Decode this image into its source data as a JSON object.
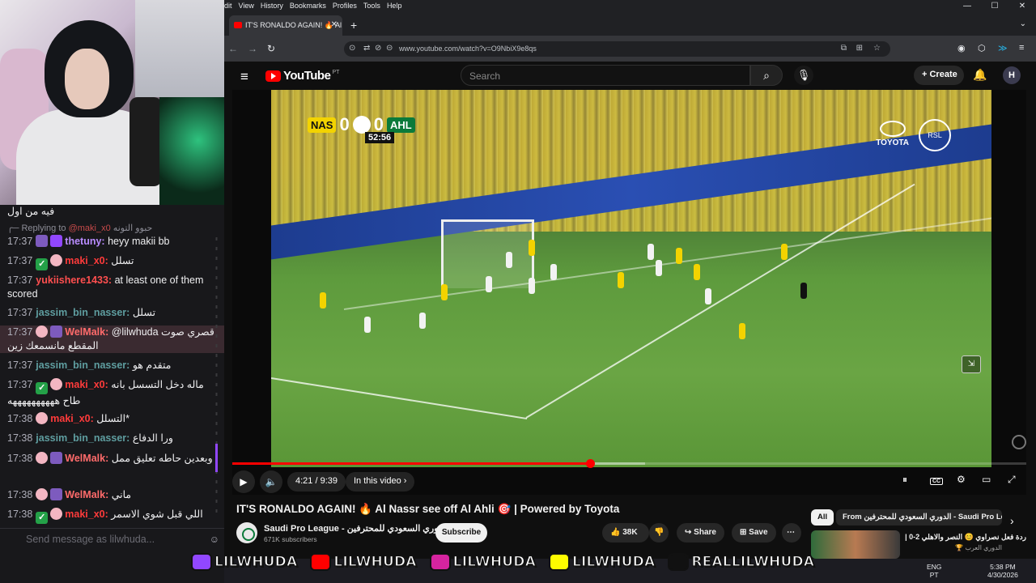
{
  "colors": {
    "accent": "#ff0000",
    "twitch_purple": "#9147ff",
    "chat_bg": "#18181b",
    "yt_bg": "#0f0f0f"
  },
  "browser": {
    "menu": [
      "dit",
      "View",
      "History",
      "Bookmarks",
      "Profiles",
      "Tools",
      "Help"
    ],
    "tab_title": "IT'S RONALDO AGAIN! 🔥 Al N",
    "url": "www.youtube.com/watch?v=O9NbiX9e8qs"
  },
  "youtube": {
    "logo_text": "YouTube",
    "region": "PT",
    "search_placeholder": "Search",
    "create_label": "Create",
    "avatar_letter": "H"
  },
  "video": {
    "scorebug": {
      "home": "NAS",
      "home_score": "0",
      "away_score": "0",
      "away": "AHL",
      "clock": "52:56"
    },
    "sponsor": "TOYOTA",
    "league_logo": "RSL",
    "time": "4:21 / 9:39",
    "progress_played": 0.451,
    "progress_loaded": 0.52,
    "in_this_video": "In this video"
  },
  "below": {
    "title": "IT'S RONALDO AGAIN! 🔥 Al Nassr see off Al Ahli 🎯 | Powered by Toyota",
    "channel": "Saudi Pro League - الدوري السعودي للمحترفين",
    "subscribers": "671K subscribers",
    "subscribe_label": "Subscribe",
    "likes": "38K",
    "share_label": "Share",
    "save_label": "Save",
    "chip_all": "All",
    "chip_from": "From الدوري السعودي للمحترفين - Saudi Pro League",
    "rec_title": "ردة فعل نصراوي 😊 النصر والاهلي 2-0 |",
    "rec_sub": "الدوري العرب 🏆"
  },
  "chat": {
    "top_line": "فيه من اول",
    "reply_prefix": "Replying to",
    "reply_user": "@maki_x0",
    "reply_text": "حبوو التونه",
    "messages": [
      {
        "time": "17:37",
        "user": "thetuny:",
        "color": "#b98cff",
        "text": "heyy makii bb",
        "badges": [
          "sub",
          "gift"
        ]
      },
      {
        "time": "17:37",
        "user": "maki_x0:",
        "color": "#ff3b3b",
        "text": "تسلل",
        "badges": [
          "green",
          "cake"
        ]
      },
      {
        "time": "17:37",
        "user": "yukiishere1433:",
        "color": "#ff4f4f",
        "text": "at least one of them scored",
        "badges": []
      },
      {
        "time": "17:37",
        "user": "jassim_bin_nasser:",
        "color": "#5f9ea0",
        "text": "تسلل",
        "badges": []
      },
      {
        "time": "17:37",
        "user": "WelMalk:",
        "color": "#ff6b6b",
        "text": "@lilwhuda قصري صوت المقطع مانسمعك زين",
        "badges": [
          "cake",
          "sub"
        ]
      },
      {
        "time": "17:37",
        "user": "jassim_bin_nasser:",
        "color": "#5f9ea0",
        "text": "متقدم هو",
        "badges": []
      },
      {
        "time": "17:37",
        "user": "maki_x0:",
        "color": "#ff3b3b",
        "text": "ماله دخل التسسل بانه طاح ههههههههههه",
        "badges": [
          "green",
          "cake"
        ]
      },
      {
        "time": "17:38",
        "user": "maki_x0:",
        "color": "#ff3b3b",
        "text": "التسلل*",
        "badges": [
          "cake"
        ]
      },
      {
        "time": "17:38",
        "user": "jassim_bin_nasser:",
        "color": "#5f9ea0",
        "text": "ورا الدفاع",
        "badges": []
      },
      {
        "time": "17:38",
        "user": "WelMalk:",
        "color": "#ff6b6b",
        "text": "وبعدين حاطه تعليق ممل",
        "badges": [
          "cake",
          "sub"
        ]
      },
      {
        "time": "17:38",
        "user": "WelMalk:",
        "color": "#ff6b6b",
        "text": "ماني",
        "badges": [
          "cake",
          "sub"
        ]
      },
      {
        "time": "17:38",
        "user": "maki_x0:",
        "color": "#ff3b3b",
        "text": "اللي قبل شوي الاسمر",
        "badges": [
          "green",
          "cake"
        ]
      }
    ],
    "input_placeholder": "Send message as lilwhuda..."
  },
  "socials": [
    {
      "platform": "twitch",
      "handle": "LILWHUDA",
      "color": "#9147ff"
    },
    {
      "platform": "youtube",
      "handle": "LILWHUDA",
      "color": "#ff0000"
    },
    {
      "platform": "instagram",
      "handle": "LILWHUDA",
      "color": "#d6249f"
    },
    {
      "platform": "snapchat",
      "handle": "LILWHUDA",
      "color": "#fffc00"
    },
    {
      "platform": "tiktok",
      "handle": "REALLILWHUDA",
      "color": "#111111"
    }
  ],
  "tray": {
    "lang": "ENG",
    "lang2": "PT",
    "time": "5:38 PM",
    "date": "4/30/2026"
  }
}
